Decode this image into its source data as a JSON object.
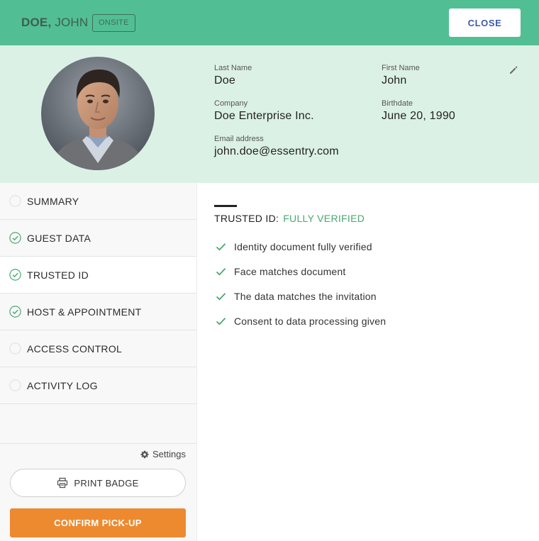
{
  "header": {
    "last_name": "DOE,",
    "first_name": "JOHN",
    "status_badge": "ONSITE",
    "close_label": "CLOSE"
  },
  "profile": {
    "last_name": {
      "label": "Last Name",
      "value": "Doe"
    },
    "first_name": {
      "label": "First Name",
      "value": "John"
    },
    "company": {
      "label": "Company",
      "value": "Doe Enterprise Inc."
    },
    "birthdate": {
      "label": "Birthdate",
      "value": "June 20, 1990"
    },
    "email": {
      "label": "Email address",
      "value": "john.doe@essentry.com"
    }
  },
  "sidebar": {
    "items": [
      {
        "label": "SUMMARY",
        "done": false
      },
      {
        "label": "GUEST DATA",
        "done": true
      },
      {
        "label": "TRUSTED ID",
        "done": true,
        "active": true
      },
      {
        "label": "HOST & APPOINTMENT",
        "done": true
      },
      {
        "label": "ACCESS CONTROL",
        "done": false
      },
      {
        "label": "ACTIVITY LOG",
        "done": false
      }
    ],
    "settings_label": "Settings",
    "print_badge_label": "PRINT BADGE",
    "confirm_label": "CONFIRM PICK-UP"
  },
  "main": {
    "section_label": "TRUSTED ID:",
    "section_status": "FULLY VERIFIED",
    "checks": [
      "Identity document fully verified",
      "Face matches document",
      "The data matches the invitation",
      "Consent to data processing given"
    ]
  },
  "colors": {
    "header_bg": "#52be93",
    "profile_bg": "#dcf1e6",
    "accent_green": "#47a872",
    "close_text": "#3f5ba9",
    "confirm_bg": "#ed8a30"
  },
  "icons": {
    "edit": "pencil-icon",
    "settings": "gear-icon",
    "print": "printer-icon",
    "check": "check-icon",
    "done": "check-circle-icon",
    "pending": "empty-circle-icon"
  }
}
